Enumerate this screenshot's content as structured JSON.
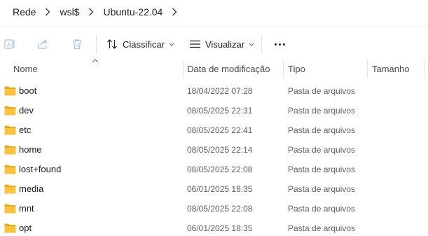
{
  "breadcrumb": {
    "items": [
      "Rede",
      "wsl$",
      "Ubuntu-22.04"
    ]
  },
  "toolbar": {
    "sort_label": "Classificar",
    "view_label": "Visualizar",
    "icons": [
      "rename-icon",
      "share-icon",
      "delete-icon",
      "sort-icon",
      "view-icon",
      "more-icon"
    ]
  },
  "columns": {
    "name": "Nome",
    "date": "Data de modificação",
    "type": "Tipo",
    "size": "Tamanho"
  },
  "files": [
    {
      "name": "boot",
      "date": "18/04/2022 07:28",
      "type": "Pasta de arquivos",
      "size": ""
    },
    {
      "name": "dev",
      "date": "08/05/2025 22:31",
      "type": "Pasta de arquivos",
      "size": ""
    },
    {
      "name": "etc",
      "date": "08/05/2025 22:41",
      "type": "Pasta de arquivos",
      "size": ""
    },
    {
      "name": "home",
      "date": "08/05/2025 22:14",
      "type": "Pasta de arquivos",
      "size": ""
    },
    {
      "name": "lost+found",
      "date": "08/05/2025 22:08",
      "type": "Pasta de arquivos",
      "size": ""
    },
    {
      "name": "media",
      "date": "06/01/2025 18:35",
      "type": "Pasta de arquivos",
      "size": ""
    },
    {
      "name": "mnt",
      "date": "08/05/2025 22:08",
      "type": "Pasta de arquivos",
      "size": ""
    },
    {
      "name": "opt",
      "date": "06/01/2025 18:35",
      "type": "Pasta de arquivos",
      "size": ""
    }
  ],
  "colors": {
    "folder": "#f6c343",
    "folder_dark": "#e8a91f",
    "disabled_icon": "#a8c0d8",
    "divider": "#e3e3e3"
  }
}
